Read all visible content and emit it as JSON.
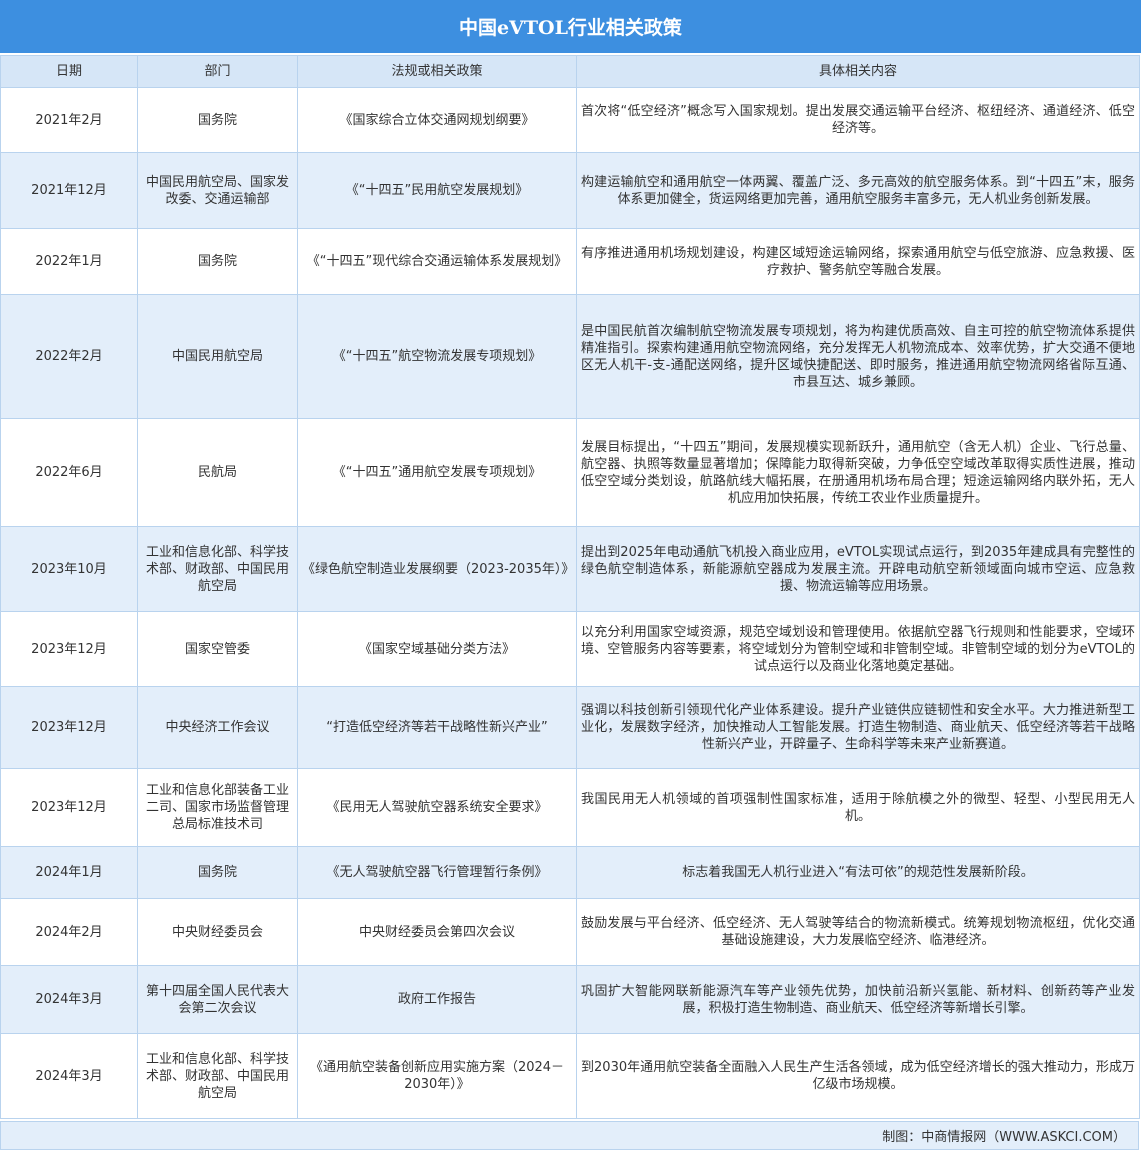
{
  "title": "中国eVTOL行业相关政策",
  "headers": [
    "日期",
    "部门",
    "法规或相关政策",
    "具体相关内容"
  ],
  "rows": [
    {
      "date": "2021年2月",
      "dept": "国务院",
      "policy": "《国家综合立体交通网规划纲要》",
      "content": "首次将“低空经济”概念写入国家规划。提出发展交通运输平台经济、枢纽经济、通道经济、低空经济等。"
    },
    {
      "date": "2021年12月",
      "dept": "中国民用航空局、国家发改委、交通运输部",
      "policy": "《“十四五”民用航空发展规划》",
      "content": "构建运输航空和通用航空一体两翼、覆盖广泛、多元高效的航空服务体系。到“十四五”末，服务体系更加健全，货运网络更加完善，通用航空服务丰富多元，无人机业务创新发展。"
    },
    {
      "date": "2022年1月",
      "dept": "国务院",
      "policy": "《“十四五”现代综合交通运输体系发展规划》",
      "content": "有序推进通用机场规划建设，构建区域短途运输网络，探索通用航空与低空旅游、应急救援、医疗救护、警务航空等融合发展。"
    },
    {
      "date": "2022年2月",
      "dept": "中国民用航空局",
      "policy": "《“十四五”航空物流发展专项规划》",
      "content": "是中国民航首次编制航空物流发展专项规划，将为构建优质高效、自主可控的航空物流体系提供精准指引。探索构建通用航空物流网络，充分发挥无人机物流成本、效率优势，扩大交通不便地区无人机干-支-通配送网络，提升区域快捷配送、即时服务，推进通用航空物流网络省际互通、市县互达、城乡兼顾。"
    },
    {
      "date": "2022年6月",
      "dept": "民航局",
      "policy": "《“十四五”通用航空发展专项规划》",
      "content": "发展目标提出，“十四五”期间，发展规模实现新跃升，通用航空（含无人机）企业、飞行总量、航空器、执照等数量显著增加；保障能力取得新突破，力争低空空域改革取得实质性进展，推动低空空域分类划设，航路航线大幅拓展，在册通用机场布局合理；短途运输网络内联外拓，无人机应用加快拓展，传统工农业作业质量提升。"
    },
    {
      "date": "2023年10月",
      "dept": "工业和信息化部、科学技术部、财政部、中国民用航空局",
      "policy": "《绿色航空制造业发展纲要（2023-2035年）》",
      "content": "提出到2025年电动通航飞机投入商业应用，eVTOL实现试点运行，到2035年建成具有完整性的绿色航空制造体系，新能源航空器成为发展主流。开辟电动航空新领域面向城市空运、应急救援、物流运输等应用场景。"
    },
    {
      "date": "2023年12月",
      "dept": "国家空管委",
      "policy": "《国家空域基础分类方法》",
      "content": "以充分利用国家空域资源，规范空域划设和管理使用。依据航空器飞行规则和性能要求，空域环境、空管服务内容等要素，将空域划分为管制空域和非管制空域。非管制空域的划分为eVTOL的试点运行以及商业化落地奠定基础。"
    },
    {
      "date": "2023年12月",
      "dept": "中央经济工作会议",
      "policy": "“打造低空经济等若干战略性新兴产业”",
      "content": "强调以科技创新引领现代化产业体系建设。提升产业链供应链韧性和安全水平。大力推进新型工业化，发展数字经济，加快推动人工智能发展。打造生物制造、商业航天、低空经济等若干战略性新兴产业，开辟量子、生命科学等未来产业新赛道。"
    },
    {
      "date": "2023年12月",
      "dept": "工业和信息化部装备工业二司、国家市场监督管理总局标准技术司",
      "policy": "《民用无人驾驶航空器系统安全要求》",
      "content": "我国民用无人机领域的首项强制性国家标准，适用于除航模之外的微型、轻型、小型民用无人机。"
    },
    {
      "date": "2024年1月",
      "dept": "国务院",
      "policy": "《无人驾驶航空器飞行管理暂行条例》",
      "content": "标志着我国无人机行业进入“有法可依”的规范性发展新阶段。"
    },
    {
      "date": "2024年2月",
      "dept": "中央财经委员会",
      "policy": "中央财经委员会第四次会议",
      "content": "鼓励发展与平台经济、低空经济、无人驾驶等结合的物流新模式。统筹规划物流枢纽，优化交通基础设施建设，大力发展临空经济、临港经济。"
    },
    {
      "date": "2024年3月",
      "dept": "第十四届全国人民代表大会第二次会议",
      "policy": "政府工作报告",
      "content": "巩固扩大智能网联新能源汽车等产业领先优势，加快前沿新兴氢能、新材料、创新药等产业发展，积极打造生物制造、商业航天、低空经济等新增长引擎。"
    },
    {
      "date": "2024年3月",
      "dept": "工业和信息化部、科学技术部、财政部、中国民用航空局",
      "policy": "《通用航空装备创新应用实施方案（2024－2030年）》",
      "content": "到2030年通用航空装备全面融入人民生产生活各领域，成为低空经济增长的强大推动力，形成万亿级市场规模。"
    }
  ],
  "footer": "制图：中商情报网（WWW.ASKCI.COM）"
}
